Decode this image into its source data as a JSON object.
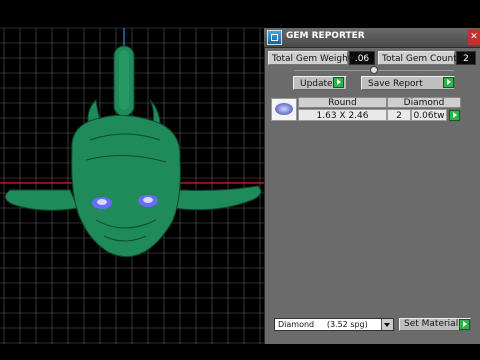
{
  "window": {
    "title": "GEM REPORTER"
  },
  "stats": {
    "weight_label": "Total Gem Weight",
    "weight_value": ".06",
    "count_label": "Total Gem Count",
    "count_value": "2"
  },
  "actions": {
    "update_label": "Update",
    "save_report_label": "Save Report"
  },
  "table": {
    "headers": [
      "Round",
      "Diamond"
    ],
    "rows": [
      {
        "size": "1.63 X 2.46",
        "count": "2",
        "weight": "0.06tw"
      }
    ]
  },
  "material": {
    "selected": "Diamond     (3.52 spg)",
    "set_label": "Set Material"
  },
  "icons": {
    "panel": "gem-reporter-icon",
    "close": "close-icon",
    "go": "play-arrow-icon",
    "dropdown": "chevron-down-icon",
    "gem": "round-gem-icon"
  },
  "colors": {
    "model": "#1f8a5a",
    "eyes": "#6a6aff",
    "accent_go": "#2fb34a",
    "axis_red": "#d02020",
    "axis_blue": "#3090e0"
  }
}
